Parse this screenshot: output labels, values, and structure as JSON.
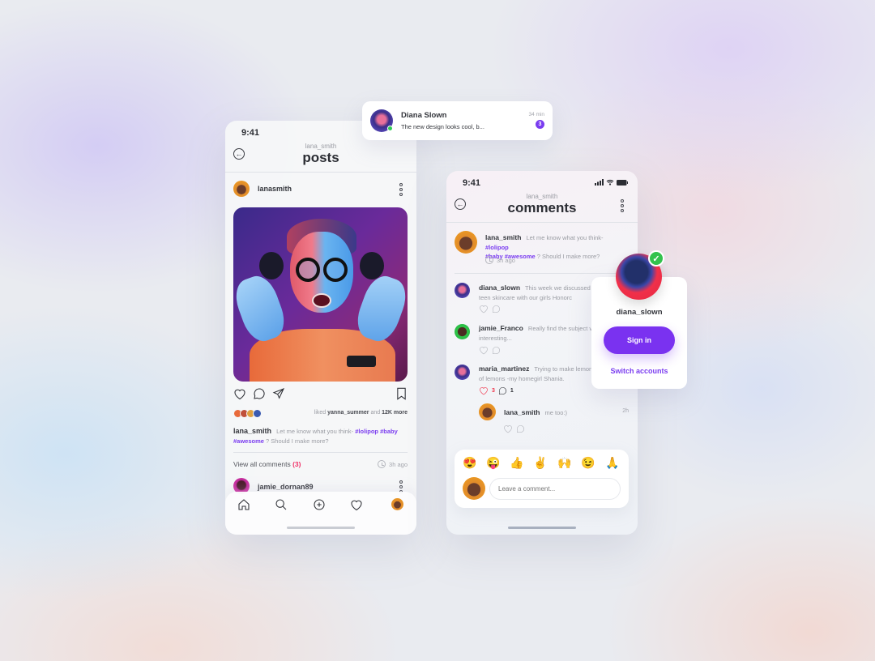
{
  "notification": {
    "name": "Diana Slown",
    "message": "The new design looks cool, b...",
    "time": "34 min",
    "unread_count": "3",
    "avatar_icon": "user-avatar"
  },
  "posts_screen": {
    "status_time": "9:41",
    "header_user": "lana_smith",
    "title": "posts",
    "post": {
      "author": "lanasmith",
      "liked_by_prefix": "liked",
      "liked_by_user": "yanna_summer",
      "liked_by_and": "and",
      "liked_by_more": "12K more",
      "caption_user": "lana_smith",
      "caption_text": "Let me know what you think-",
      "caption_tags_1": "#lolipop #baby",
      "caption_tags_2": "#awesome",
      "caption_tail": "? Should I make more?",
      "view_all_label": "View all comments",
      "comment_count": "(3)",
      "time_ago": "3h ago",
      "next_author": "jamie_dornan89"
    },
    "nav": [
      {
        "name": "home",
        "icon": "home-icon"
      },
      {
        "name": "search",
        "icon": "search-icon"
      },
      {
        "name": "add",
        "icon": "plus-circle-icon"
      },
      {
        "name": "activity",
        "icon": "heart-icon"
      },
      {
        "name": "profile",
        "icon": "avatar"
      }
    ]
  },
  "comments_screen": {
    "status_time": "9:41",
    "header_user": "lana_smith",
    "title": "comments",
    "original": {
      "user": "lana_smith",
      "text": "Let me know what you think-",
      "tags_1": "#lolipop",
      "tags_2": "#baby #awesome",
      "tail": "? Should I make more?",
      "time": "3h ago"
    },
    "comments": [
      {
        "user": "diana_slown",
        "text": "This week we discussed all things teen skincare with our girls Honorc"
      },
      {
        "user": "jamie_Franco",
        "text": "Really find the subject very interesting..."
      },
      {
        "user": "maria_martinez",
        "text": "Trying to make lemonade out of lemons -my homegirl Shania.",
        "likes": "3",
        "replies": "1"
      }
    ],
    "reply": {
      "user": "lana_smith",
      "text": "me too:)",
      "time": "2h"
    },
    "emojis": [
      "😍",
      "😜",
      "👍",
      "✌️",
      "🙌",
      "😉",
      "🙏"
    ],
    "input_placeholder": "Leave a comment..."
  },
  "account_card": {
    "username": "diana_slown",
    "sign_in_label": "Sign in",
    "switch_label": "Switch accounts"
  },
  "colors": {
    "accent": "#7a32f0",
    "hashtag": "#7a3cf0",
    "count_pink": "#f0346a",
    "like_red": "#f0344a",
    "online_green": "#2ecc55"
  }
}
